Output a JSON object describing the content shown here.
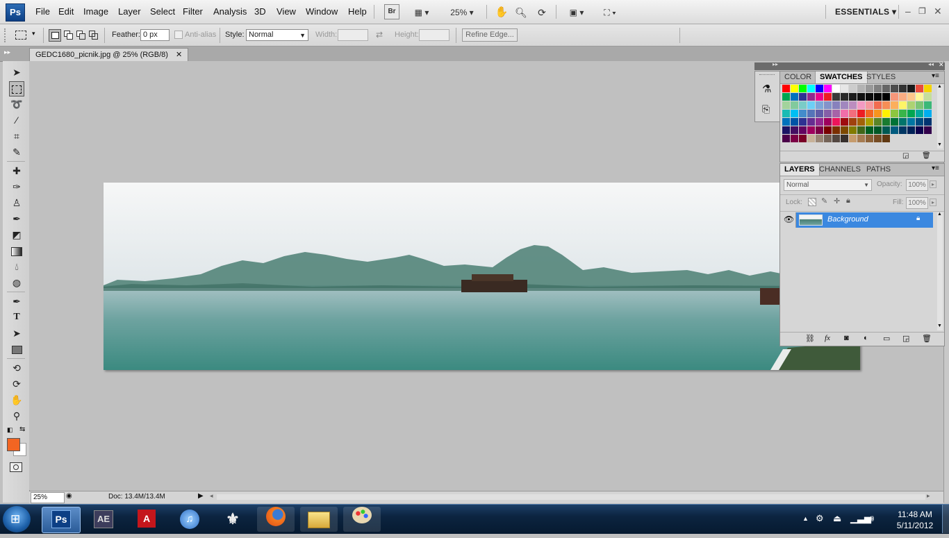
{
  "app": {
    "logo": "Ps",
    "workspace": "ESSENTIALS",
    "zoom_menu": "25%",
    "bridge_label": "Br"
  },
  "menu": [
    "File",
    "Edit",
    "Image",
    "Layer",
    "Select",
    "Filter",
    "Analysis",
    "3D",
    "View",
    "Window",
    "Help"
  ],
  "options": {
    "feather_label": "Feather:",
    "feather_value": "0 px",
    "antialias_label": "Anti-alias",
    "style_label": "Style:",
    "style_value": "Normal",
    "width_label": "Width:",
    "height_label": "Height:",
    "refine_edge": "Refine Edge..."
  },
  "document": {
    "tab_title": "GEDC1680_picnik.jpg @ 25% (RGB/8)"
  },
  "status": {
    "zoom": "25%",
    "doc_size": "Doc: 13.4M/13.4M"
  },
  "swatch_panel": {
    "tabs": [
      "COLOR",
      "SWATCHES",
      "STYLES"
    ],
    "active": "SWATCHES"
  },
  "layers_panel": {
    "tabs": [
      "LAYERS",
      "CHANNELS",
      "PATHS"
    ],
    "active": "LAYERS",
    "blend_mode": "Normal",
    "opacity_label": "Opacity:",
    "opacity_value": "100%",
    "lock_label": "Lock:",
    "fill_label": "Fill:",
    "fill_value": "100%",
    "layers": [
      {
        "name": "Background",
        "visible": true,
        "locked": true
      }
    ]
  },
  "colors": {
    "foreground": "#f26522",
    "background": "#ffffff",
    "selection": "#3b88e0"
  },
  "swatches": [
    [
      "#ff0000",
      "#ffff00",
      "#00ff00",
      "#00ffff",
      "#0000ff",
      "#ff00ff",
      "#ffffff",
      "#e6e6e6",
      "#cccccc",
      "#b3b3b3",
      "#999999",
      "#808080",
      "#666666",
      "#4d4d4d",
      "#333333",
      "#1a1a1a",
      "#e84c3d",
      "#f5d400"
    ],
    [
      "#00a651",
      "#0072bc",
      "#2e3192",
      "#92278f",
      "#ec008c",
      "#ed1c24",
      "#3a3a3a",
      "#2a2a2a",
      "#1c1c1c",
      "#111111",
      "#0b0b0b",
      "#050505",
      "#000000",
      "#f7977a",
      "#fbad82",
      "#fdc68a",
      "#fff79a",
      "#c4df9b"
    ],
    [
      "#a3d39c",
      "#82ca9d",
      "#7accc8",
      "#6dcff6",
      "#7da7d9",
      "#8393ca",
      "#8781bd",
      "#a187be",
      "#bc8dbf",
      "#f49ac2",
      "#f6989d",
      "#f26c4f",
      "#f68e56",
      "#fbaf5d",
      "#fff568",
      "#acd372",
      "#7cc576",
      "#3bb878"
    ],
    [
      "#1abbb4",
      "#00bff3",
      "#438ccb",
      "#5574b9",
      "#605ca8",
      "#855fa8",
      "#a763a8",
      "#f06ea9",
      "#f26d7d",
      "#ed1c24",
      "#f26522",
      "#f7941d",
      "#fff200",
      "#8dc63f",
      "#39b54a",
      "#00a651",
      "#00a99d",
      "#00aeef"
    ],
    [
      "#0072bc",
      "#0054a6",
      "#2e3192",
      "#662d91",
      "#92278f",
      "#9e005d",
      "#ed145b",
      "#9e0b0f",
      "#a0410d",
      "#a36209",
      "#aba000",
      "#598527",
      "#197b30",
      "#007236",
      "#00746b",
      "#0076a3",
      "#004b80",
      "#003471"
    ],
    [
      "#1b1464",
      "#440e62",
      "#630460",
      "#9e005d",
      "#7b0046",
      "#790000",
      "#7b2e00",
      "#7d4900",
      "#827b00",
      "#406618",
      "#005e20",
      "#005826",
      "#005952",
      "#005b7f",
      "#003663",
      "#002157",
      "#0d004c",
      "#32004b"
    ],
    [
      "#4b0049",
      "#7b0046",
      "#7a0026",
      "#c7b299",
      "#998675",
      "#736357",
      "#534741",
      "#37302d",
      "#c69c6d",
      "#a67c52",
      "#8c6239",
      "#754c24",
      "#603913",
      "",
      ""
    ]
  ]
}
